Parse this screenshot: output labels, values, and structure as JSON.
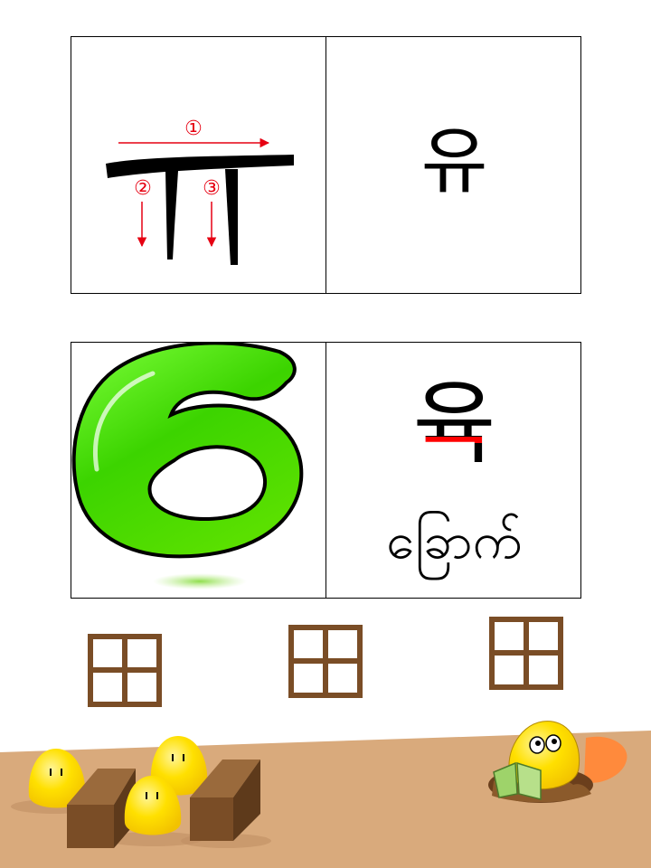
{
  "stroke_card": {
    "step_labels": [
      "①",
      "②",
      "③"
    ],
    "syllable": "유"
  },
  "vocab_card": {
    "syllable": "육",
    "myanmar_word": "ခြောက်",
    "number_glyph": "6"
  },
  "colors": {
    "stroke_guide": "#e60012",
    "highlight_bar": "#ff0000",
    "number_green": "#3cd400",
    "ground": "#d9aa7c",
    "window_frame": "#7a4d26",
    "chick_yellow": "#ffe000",
    "book_green": "#9ed36a"
  },
  "scene": {
    "windows": 3,
    "chicks": 3,
    "blocks": 2,
    "reading_chick_icon": "reading-chick"
  }
}
